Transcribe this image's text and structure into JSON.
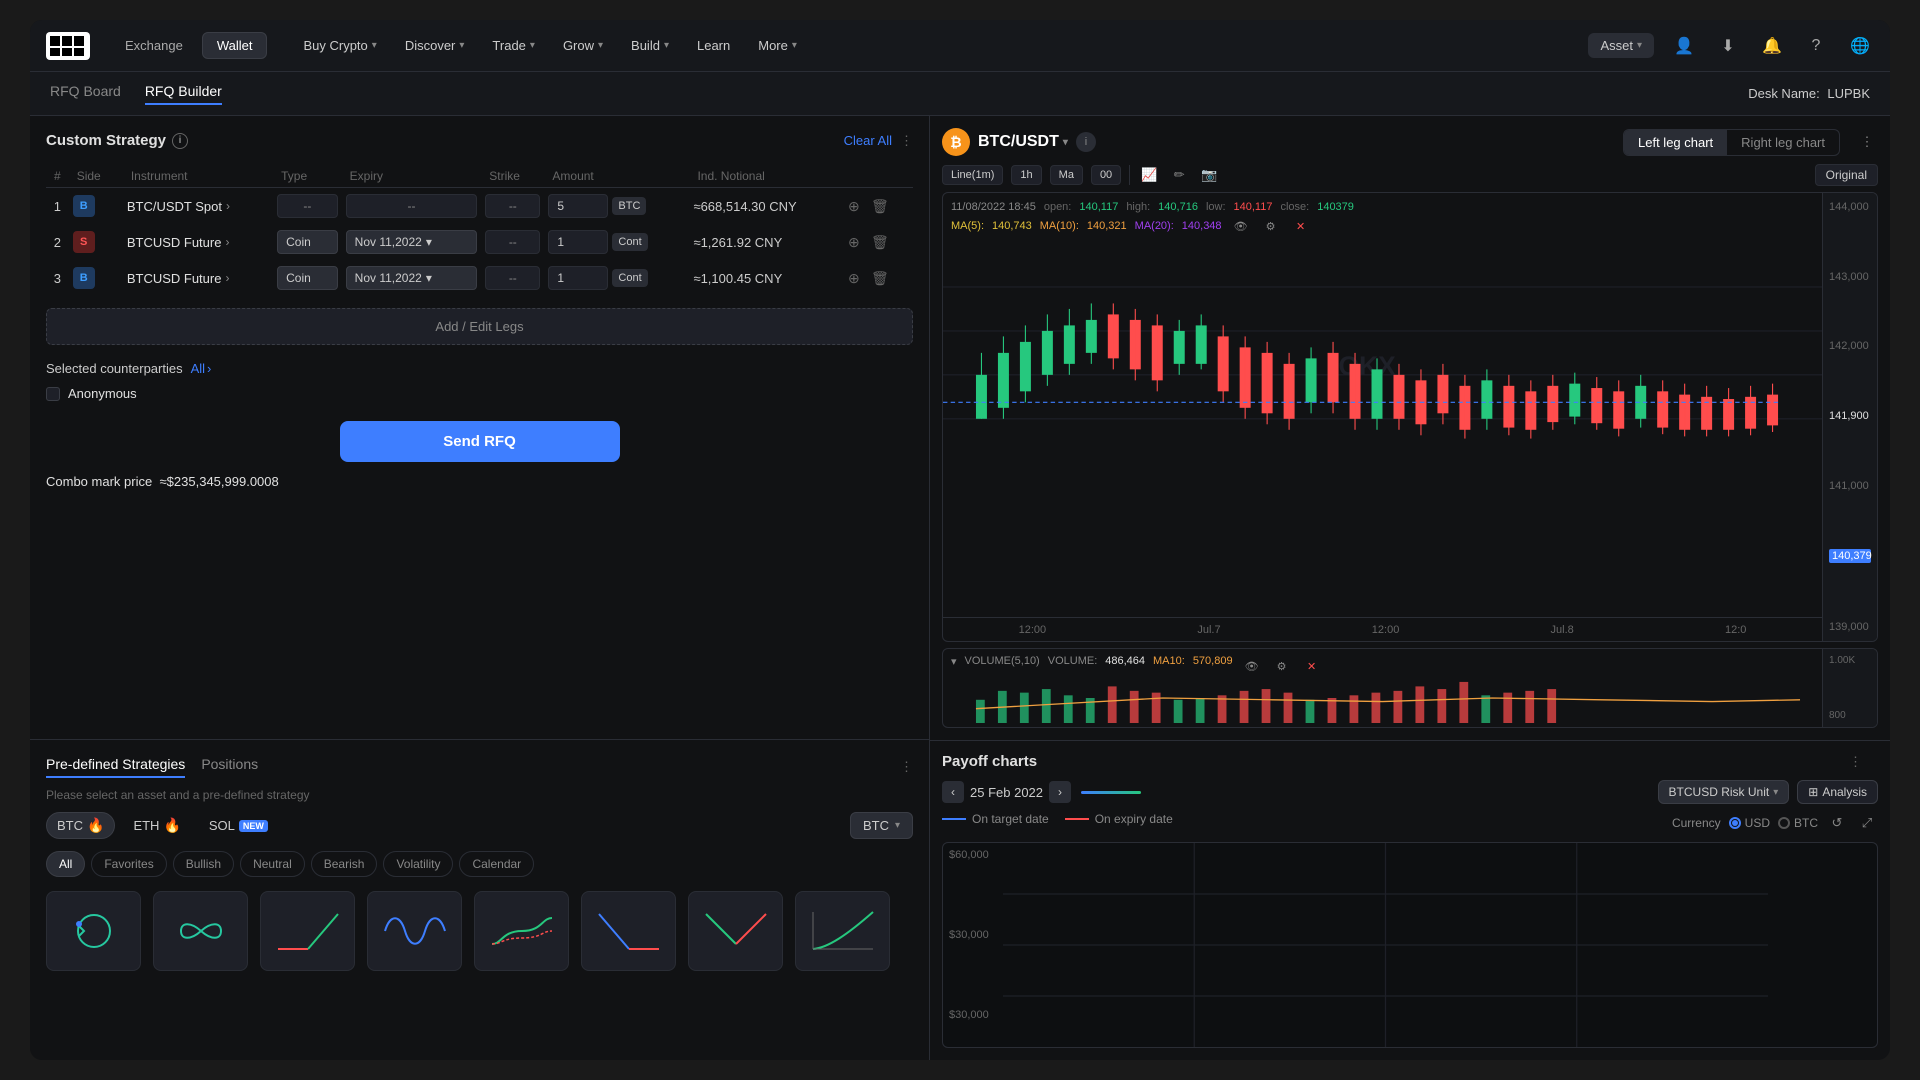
{
  "nav": {
    "logo": "OKX",
    "tab_exchange": "Exchange",
    "tab_wallet": "Wallet",
    "menu_buy_crypto": "Buy Crypto",
    "menu_discover": "Discover",
    "menu_trade": "Trade",
    "menu_grow": "Grow",
    "menu_build": "Build",
    "menu_learn": "Learn",
    "menu_more": "More",
    "asset_btn": "Asset",
    "desk_label": "Desk Name:",
    "desk_name": "LUPBK"
  },
  "sub_nav": {
    "tab_rfq_board": "RFQ Board",
    "tab_rfq_builder": "RFQ Builder"
  },
  "rfq_builder": {
    "title": "Custom Strategy",
    "clear_all": "Clear All",
    "columns": {
      "hash": "#",
      "side": "Side",
      "instrument": "Instrument",
      "type": "Type",
      "expiry": "Expiry",
      "strike": "Strike",
      "amount": "Amount",
      "ind_notional": "Ind. Notional"
    },
    "legs": [
      {
        "num": "1",
        "side": "B",
        "side_type": "buy",
        "instrument": "BTC/USDT Spot",
        "type": "--",
        "expiry": "--",
        "strike": "--",
        "amount": "5",
        "unit": "BTC",
        "notional": "≈668,514.30 CNY"
      },
      {
        "num": "2",
        "side": "S",
        "side_type": "sell",
        "instrument": "BTCUSD Future",
        "type": "Coin",
        "expiry": "Nov 11,2022",
        "strike": "--",
        "amount": "1",
        "unit": "Cont",
        "notional": "≈1,261.92 CNY"
      },
      {
        "num": "3",
        "side": "B",
        "side_type": "buy",
        "instrument": "BTCUSD Future",
        "type": "Coin",
        "expiry": "Nov 11,2022",
        "strike": "--",
        "amount": "1",
        "unit": "Cont",
        "notional": "≈1,100.45 CNY"
      }
    ],
    "add_legs_label": "Add / Edit Legs",
    "selected_counterparties": "Selected counterparties",
    "all_label": "All",
    "anonymous_label": "Anonymous",
    "send_rfq_label": "Send RFQ",
    "combo_price_label": "Combo mark price",
    "combo_price_value": "≈$235,345,999.0008"
  },
  "pre_defined": {
    "tab_strategies": "Pre-defined Strategies",
    "tab_positions": "Positions",
    "hint": "Please select an asset and a pre-defined strategy",
    "assets": [
      "BTC",
      "ETH",
      "SOL"
    ],
    "asset_btc_icon": "🔥",
    "asset_eth_icon": "🔥",
    "asset_sol_new": "NEW",
    "select_label": "BTC",
    "categories": [
      "All",
      "Favorites",
      "Bullish",
      "Neutral",
      "Bearish",
      "Volatility",
      "Calendar"
    ]
  },
  "chart": {
    "pair": "BTC/USDT",
    "pair_icon": "₿",
    "left_leg": "Left leg chart",
    "right_leg": "Right leg chart",
    "time_frame": "Line(1m)",
    "interval": "1h",
    "agg": "Ma",
    "candle_info": "11/08/2022 18:45",
    "open_label": "open:",
    "open_val": "140,117",
    "high_label": "high:",
    "high_val": "140,716",
    "low_label": "low:",
    "low_val": "140,117",
    "close_label": "close:",
    "close_val": "140379",
    "ma5_label": "MA(5):",
    "ma5_val": "140,743",
    "ma10_label": "MA(10):",
    "ma10_val": "140,321",
    "ma20_label": "MA(20):",
    "ma20_val": "140,348",
    "current_price": "140,379",
    "y_labels": [
      "144,000",
      "143,000",
      "142,000",
      "141,000",
      "141,900",
      "140,379",
      "139,000"
    ],
    "x_labels": [
      "12:00",
      "Jul.7",
      "12:00",
      "Jul.8",
      "12:0"
    ],
    "volume_label": "VOLUME(5,10)",
    "volume_val": "486,464",
    "ma10_volume_label": "MA10:",
    "ma10_val_volume": "570,809",
    "original": "Original"
  },
  "payoff": {
    "title": "Payoff charts",
    "date": "25 Feb 2022",
    "risk_unit": "BTCUSD Risk Unit",
    "analysis_label": "Analysis",
    "on_target_label": "On target date",
    "on_expiry_label": "On expiry date",
    "currency_label": "Currency",
    "currency_usd": "USD",
    "currency_btc": "BTC",
    "y_labels": [
      "$60,000",
      "$30,000",
      "$30,000"
    ]
  }
}
